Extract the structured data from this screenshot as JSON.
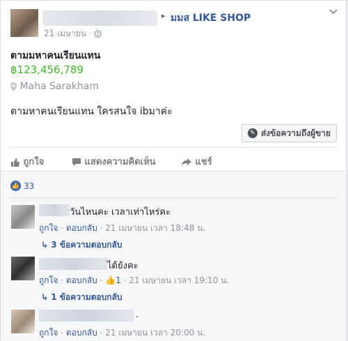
{
  "post": {
    "group_name": "มมส LIKE SHOP",
    "arrow": "▸",
    "date": "21 เมษายน",
    "title": "ตามมหาคนเรียนแทน",
    "price": "฿123,456,789",
    "location": "Maha Sarakham",
    "description": "ตามหาคนเรียนแทน ใครสนใจ ibมาค่ะ",
    "message_button": "ส่งข้อความถึงผู้ขาย"
  },
  "actions": {
    "like": "ถูกใจ",
    "comment": "แสดงความคิดเห็น",
    "share": "แชร์"
  },
  "likes_count": "33",
  "comments": [
    {
      "text": "วันไหนคะ เวลาเท่าไหร่คะ",
      "like": "ถูกใจ",
      "reply": "ตอบกลับ",
      "time": "21 เมษายน เวลา 18:48 น.",
      "replies_label": "3 ข้อความตอบกลับ"
    },
    {
      "text": "ได้ยังคะ",
      "like": "ถูกใจ",
      "reply": "ตอบกลับ",
      "likes": "1",
      "time": "21 เมษายน เวลา 19:10 น.",
      "replies_label": "1 ข้อความตอบกลับ"
    },
    {
      "text": ".",
      "like": "ถูกใจ",
      "reply": "ตอบกลับ",
      "time": "21 เมษายน เวลา 20:00 น."
    }
  ],
  "colors": {
    "link": "#365899",
    "price": "#42b72a",
    "like_badge": "#4267b2"
  }
}
